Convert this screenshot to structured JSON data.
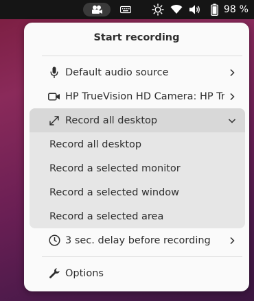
{
  "topbar": {
    "battery_text": "98 %",
    "icons": [
      "screencast-icon",
      "keyboard-icon",
      "brightness-icon",
      "wifi-icon",
      "volume-icon",
      "battery-icon"
    ]
  },
  "menu": {
    "title": "Start recording",
    "audio_label": "Default audio source",
    "camera_label": "HP TrueVision HD Camera: HP Tru",
    "area_label": "Record all desktop",
    "area_options": [
      "Record all desktop",
      "Record a selected monitor",
      "Record a selected window",
      "Record a selected area"
    ],
    "delay_label": "3 sec. delay before recording",
    "options_label": "Options"
  },
  "colors": {
    "panel_bg": "#fafafa",
    "submenu_bg": "#e6e6e6",
    "submenu_header_bg": "#d8d8d8",
    "text": "#2e2e2e",
    "topbar_bg": "#151515"
  }
}
